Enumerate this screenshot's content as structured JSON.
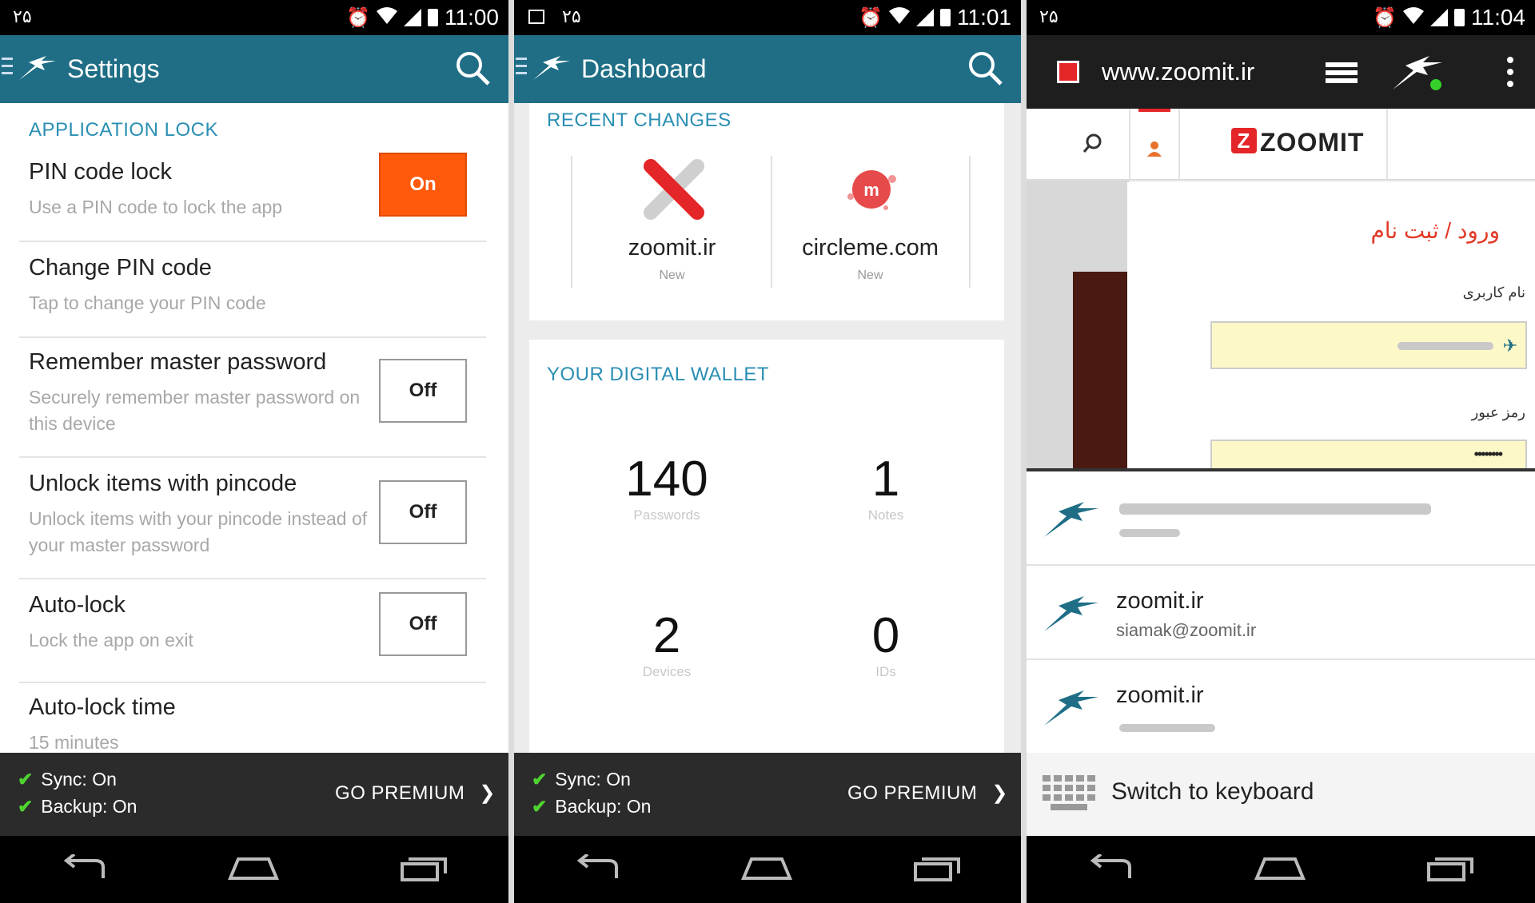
{
  "status": {
    "left_text": "۲۵",
    "p1_time": "11:00",
    "p2_time": "11:01",
    "p3_time": "11:04"
  },
  "settings": {
    "title": "Settings",
    "section": "APPLICATION LOCK",
    "rows": [
      {
        "title": "PIN code lock",
        "subtitle": "Use a PIN code to lock the app",
        "toggle": "On"
      },
      {
        "title": "Change PIN code",
        "subtitle": "Tap to change your PIN code"
      },
      {
        "title": "Remember master password",
        "subtitle": "Securely remember master password on this device",
        "toggle": "Off"
      },
      {
        "title": "Unlock items with pincode",
        "subtitle": "Unlock items with your pincode instead of your master password",
        "toggle": "Off"
      },
      {
        "title": "Auto-lock",
        "subtitle": "Lock the app on exit",
        "toggle": "Off"
      },
      {
        "title": "Auto-lock time",
        "subtitle": "15 minutes"
      }
    ]
  },
  "dashboard": {
    "title": "Dashboard",
    "recent_label": "RECENT CHANGES",
    "tiles": [
      {
        "name": "zoomit.ir",
        "badge": "New"
      },
      {
        "name": "circleme.com",
        "badge": "New"
      }
    ],
    "wallet_label": "YOUR DIGITAL WALLET",
    "stats": [
      {
        "value": "140",
        "label": "Passwords"
      },
      {
        "value": "1",
        "label": "Notes"
      },
      {
        "value": "2",
        "label": "Devices"
      },
      {
        "value": "0",
        "label": "IDs"
      }
    ]
  },
  "footer": {
    "sync": "Sync: On",
    "backup": "Backup: On",
    "premium": "GO PREMIUM"
  },
  "browser": {
    "url": "www.zoomit.ir",
    "site_logo": "ZOOMIT",
    "login_heading": "ورود / ثبت نام",
    "username_label": "نام کاربری",
    "password_label": "رمز عبور",
    "password_mask": "••••••••",
    "logins": [
      {
        "title": "zoomit.ir",
        "subtitle": "siamak@zoomit.ir"
      },
      {
        "title": "zoomit.ir",
        "subtitle": ""
      }
    ],
    "keyboard_label": "Switch to keyboard"
  },
  "colors": {
    "appbar": "#1f6e86",
    "accent": "#2a8fb3",
    "toggle_on": "#ff5a0c",
    "check": "#4fd42f",
    "footer": "#2b2b2b"
  }
}
